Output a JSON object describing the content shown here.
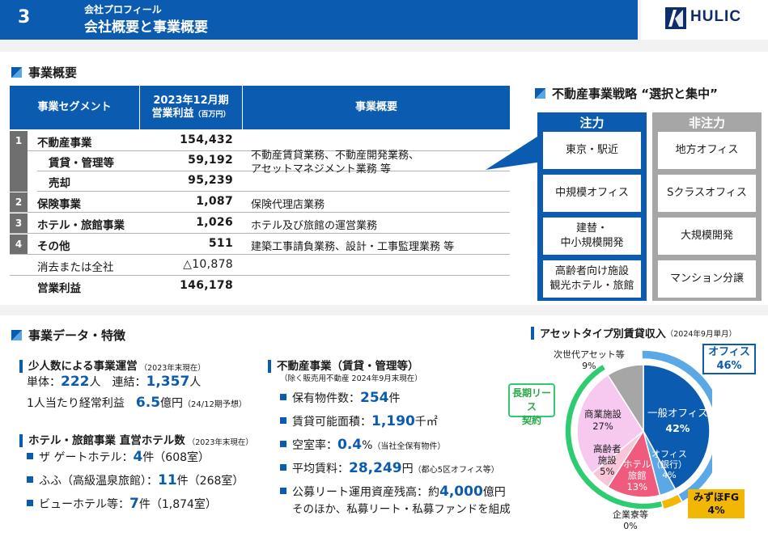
{
  "header": {
    "page_number": "3",
    "subtitle": "会社プロフィール",
    "title": "会社概要と事業概要",
    "logo_text": "HULIC"
  },
  "business_overview": {
    "section_title": "事業概要",
    "columns": [
      "事業セグメント",
      "2023年12月期",
      "営業利益",
      "（百万円）",
      "事業概要"
    ],
    "rows": [
      {
        "no": "1",
        "segment": "不動産事業",
        "value": "154,432"
      },
      {
        "no": "",
        "segment": "賃貸・管理等",
        "value": "59,192"
      },
      {
        "no": "",
        "segment": "売却",
        "value": "95,239"
      },
      {
        "no": "2",
        "segment": "保険事業",
        "value": "1,087",
        "desc": "保険代理店業務"
      },
      {
        "no": "3",
        "segment": "ホテル・旅館事業",
        "value": "1,026",
        "desc": "ホテル及び旅館の運営業務"
      },
      {
        "no": "4",
        "segment": "その他",
        "value": "511",
        "desc": "建築工事請負業務、設計・工事監理業務 等"
      },
      {
        "no": "",
        "segment": "消去または全社",
        "value": "△10,878"
      },
      {
        "no": "",
        "segment": "営業利益",
        "value": "146,178"
      }
    ],
    "real_estate_desc_1": "不動産賃貸業務、不動産開発業務、",
    "real_estate_desc_2": "アセットマネジメント業務 等"
  },
  "strategy": {
    "title": "不動産事業戦略 “選択と集中”",
    "focus_header": "注力",
    "nonfocus_header": "非注力",
    "focus": [
      "東京・駅近",
      "中規模オフィス",
      "建替・",
      "中小規模開発",
      "高齢者向け施設",
      "観光ホテル・旅館"
    ],
    "nonfocus": [
      "地方オフィス",
      "Sクラスオフィス",
      "大規模開発",
      "マンション分譲"
    ]
  },
  "business_data": {
    "section_title": "事業データ・特徴",
    "small_team": {
      "title": "少人数による事業運営",
      "note": "（2023年末現在）",
      "line1_a": "単体：",
      "line1_v1": "222",
      "line1_b": "人　連結：",
      "line1_v2": "1,357",
      "line1_c": "人",
      "line2_a": "1人当たり経常利益　",
      "line2_v": "6.5",
      "line2_b": "億円",
      "line2_note": "（24/12期予想）"
    },
    "hotels": {
      "title": "ホテル・旅館事業 直営ホテル数",
      "note": "（2023年末現在）",
      "items": [
        {
          "label": "ザ ゲートホテル：",
          "value": "4",
          "unit": "件（608室）"
        },
        {
          "label": "ふふ（高級温泉旅館）：",
          "value": "11",
          "unit": "件（268室）"
        },
        {
          "label": "ビューホテル等：",
          "value": "7",
          "unit": "件（1,874室）"
        }
      ]
    },
    "real_estate": {
      "title": "不動産事業（賃貸・管理等）",
      "note": "（除く販売用不動産 2024年9月末現在）",
      "items": [
        {
          "label": "保有物件数：",
          "value": "254",
          "unit": "件",
          "extra": ""
        },
        {
          "label": "賃貸可能面積：",
          "value": "1,190",
          "unit": "千㎡",
          "extra": ""
        },
        {
          "label": "空室率：",
          "value": "0.4",
          "unit": "%",
          "extra": "（当社全保有物件）"
        },
        {
          "label": "平均賃料：",
          "value": "28,249",
          "unit": "円",
          "extra": "（都心5区オフィス等）"
        },
        {
          "label": "公募リート運用資産残高：約",
          "value": "4,000",
          "unit": "億円",
          "extra": ""
        }
      ],
      "last_line": "そのほか、私募リート・私募ファンドを組成"
    }
  },
  "chart_data": {
    "type": "pie",
    "title": "アセットタイプ別賃貸収入",
    "title_note": "（2024年9月単月）",
    "slices": [
      {
        "label": "一般オフィス",
        "value": 42,
        "color": "#0b5bb0"
      },
      {
        "label": "オフィス（銀行）",
        "value": 4,
        "color": "#5aa8e6"
      },
      {
        "label": "企業寮等",
        "value": 0,
        "color": "#d9d9d9"
      },
      {
        "label": "ホテル旅館",
        "value": 13,
        "color": "#ef5a7d"
      },
      {
        "label": "高齢者施設",
        "value": 5,
        "color": "#f8c6d8"
      },
      {
        "label": "商業施設",
        "value": 27,
        "color": "#f7c9f0"
      },
      {
        "label": "次世代アセット等",
        "value": 9,
        "color": "#a6a6a6"
      }
    ],
    "outer_ring": [
      {
        "label": "オフィス",
        "value": 46,
        "color": "#5aa8e6"
      },
      {
        "label": "みずほFG",
        "value": 4,
        "color": "#f2b705"
      }
    ],
    "long_term_label": "長期リース契約",
    "long_term_label_1": "長期リース",
    "long_term_label_2": "契約",
    "labels": {
      "office_outer": "オフィス",
      "office_outer_pct": "46%",
      "mizuho": "みずほFG",
      "mizuho_pct": "4%",
      "general_office": "一般オフィス",
      "general_office_pct": "42%",
      "office_bank_1": "オフィス",
      "office_bank_2": "（銀行）",
      "office_bank_pct": "4%",
      "hotel_1": "ホテル",
      "hotel_2": "旅館",
      "hotel_pct": "13%",
      "elderly_1": "高齢者",
      "elderly_2": "施設",
      "elderly_pct": "5%",
      "commercial": "商業施設",
      "commercial_pct": "27%",
      "nextgen": "次世代アセット等",
      "nextgen_pct": "9%",
      "dorm": "企業寮等",
      "dorm_pct": "0%"
    }
  }
}
